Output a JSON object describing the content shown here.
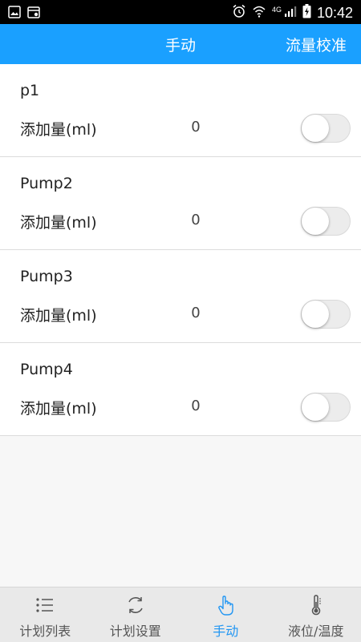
{
  "status_bar": {
    "time": "10:42",
    "network": "4G",
    "icons": [
      "image-icon",
      "calendar-icon",
      "alarm-icon",
      "wifi-icon",
      "signal-icon",
      "battery-icon"
    ]
  },
  "header": {
    "title": "手动",
    "action_label": "流量校准"
  },
  "pumps": [
    {
      "name": "p1",
      "label": "添加量(ml)",
      "value": "0",
      "enabled": false
    },
    {
      "name": "Pump2",
      "label": "添加量(ml)",
      "value": "0",
      "enabled": false
    },
    {
      "name": "Pump3",
      "label": "添加量(ml)",
      "value": "0",
      "enabled": false
    },
    {
      "name": "Pump4",
      "label": "添加量(ml)",
      "value": "0",
      "enabled": false
    }
  ],
  "tabs": [
    {
      "label": "计划列表",
      "icon": "list-icon",
      "active": false
    },
    {
      "label": "计划设置",
      "icon": "refresh-icon",
      "active": false
    },
    {
      "label": "手动",
      "icon": "hand-pointer-icon",
      "active": true
    },
    {
      "label": "液位/温度",
      "icon": "thermometer-icon",
      "active": false
    }
  ],
  "colors": {
    "accent": "#1aa0ff",
    "active_tab": "#2196f3",
    "status_bar": "#000000"
  }
}
